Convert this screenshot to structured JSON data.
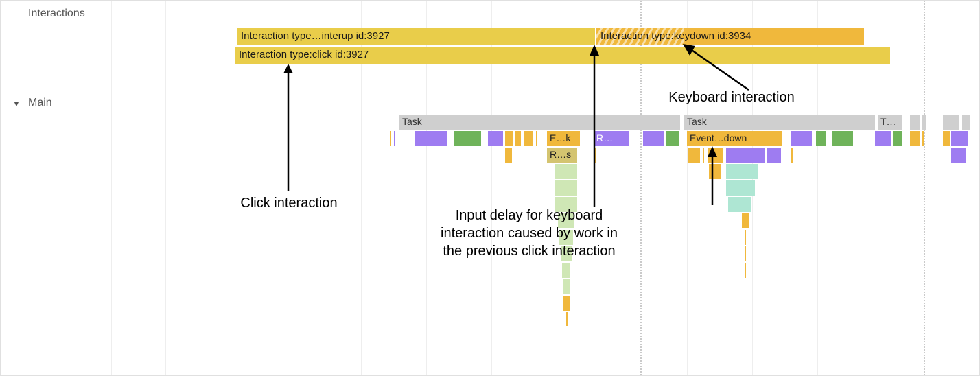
{
  "tracks": {
    "interactions_label": "Interactions",
    "main_label": "Main"
  },
  "interactions": {
    "pointerup": {
      "text": "Interaction type…interup id:3927",
      "id": "3927",
      "type": "pointerup"
    },
    "click": {
      "text": "Interaction type:click id:3927",
      "id": "3927",
      "type": "click"
    },
    "keydown": {
      "text": "Interaction type:keydown id:3934",
      "id": "3934",
      "type": "keydown"
    }
  },
  "main_tasks": {
    "task1": "Task",
    "task2": "Task",
    "task3": "T…",
    "ek": "E…k",
    "rdots": "R…",
    "rs": "R…s",
    "eventdown": "Event…down"
  },
  "annotations": {
    "click": "Click interaction",
    "keyboard": "Keyboard interaction",
    "input_delay_l1": "Input delay for keyboard",
    "input_delay_l2": "interaction caused by work in",
    "input_delay_l3": "the previous click interaction"
  },
  "icons": {
    "disclosure": "▼"
  }
}
